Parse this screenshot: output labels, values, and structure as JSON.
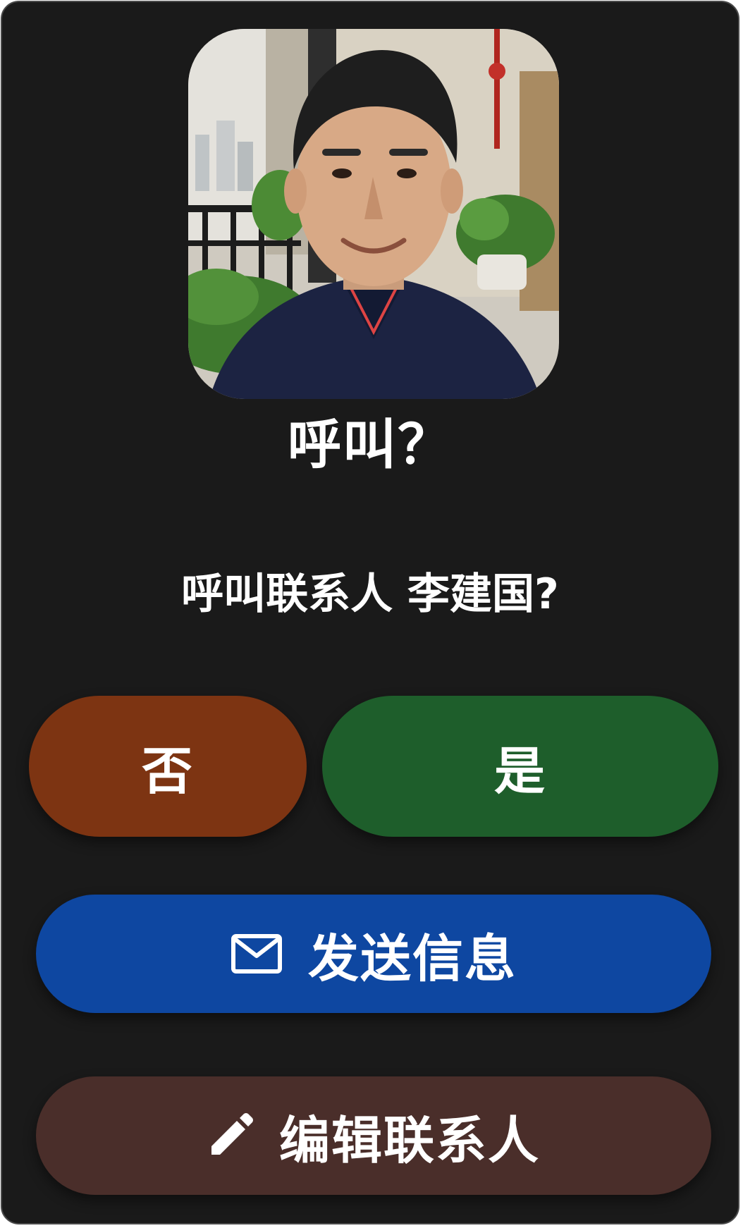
{
  "dialog": {
    "title": "呼叫？",
    "prompt": "呼叫联系人 李建国?"
  },
  "buttons": {
    "no_label": "否",
    "yes_label": "是",
    "message_label": "发送信息",
    "message_icon": "mail-icon",
    "edit_label": "编辑联系人",
    "edit_icon": "pencil-icon"
  },
  "contact": {
    "photo": "contact-avatar"
  },
  "colors": {
    "background": "#1a1a1a",
    "no_button": "#7d3412",
    "yes_button": "#1e5e2b",
    "message_button": "#0e47a1",
    "edit_button": "#4a2e2a",
    "text": "#ffffff"
  }
}
